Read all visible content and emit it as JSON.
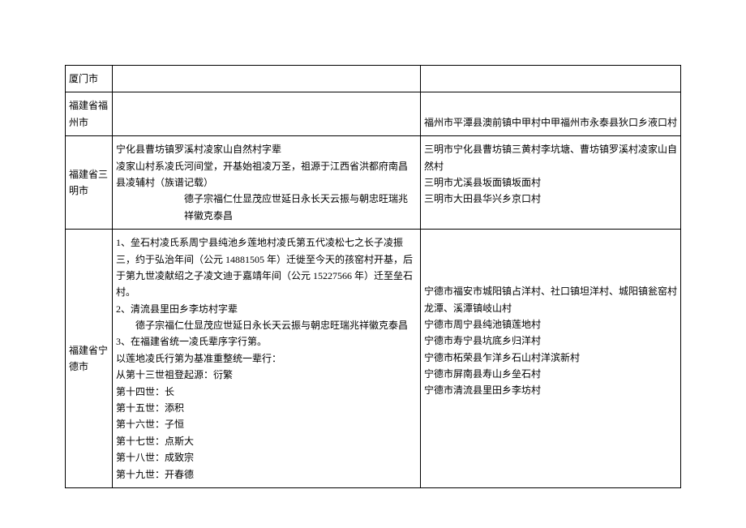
{
  "rows": [
    {
      "region": "厦门市",
      "left": [
        ""
      ],
      "right": [
        ""
      ]
    },
    {
      "region": "福建省福州市",
      "left": [
        ""
      ],
      "right": [
        "福州市平潭县澳前镇中甲村中甲福州市永泰县狄口乡液口村"
      ]
    },
    {
      "region": "福建省三明市",
      "left": [
        "宁化县曹坊镇罗溪村凌家山自然村字辈",
        "凌家山村系凌氏河间堂，开基始祖凌万圣，祖源于江西省洪都府南昌县凌辅村（族谱记载）",
        "德子宗福仁仕显茂应世延日永长天云振与朝忠旺瑞兆祥徽克泰昌"
      ],
      "right": [
        "三明市宁化县曹坊镇三黄村李坑塘、曹坊镇罗溪村凌家山自然村",
        "三明市尤溪县坂面镇坂面村",
        "三明市大田县华兴乡京口村"
      ]
    },
    {
      "region": "福建省宁德市",
      "left": [
        "1、垒石村凌氏系周宁县纯池乡莲地村凌氏第五代凌松七之长子凌振三，约于弘治年间（公元 14881505 年）迁徙至今天的孩窑村开基，后于第九世凌献绍之子凌文迪于嘉靖年间（公元 15227566 年）迁至垒石村。",
        "2、清流县里田乡李坊村字辈",
        "德子宗福仁仕显茂应世延日永长天云振与朝忠旺瑞兆祥徽克泰昌",
        "3、在福建省统一凌氏辈序字行第。",
        "以莲地凌氏行第为基准重整统一辈行：",
        "从第十三世祖登起源：衍繁",
        "第十四世：长",
        "第十五世：添积",
        "第十六世：子恒",
        "第十七世：点斯大",
        "第十八世：成致宗",
        "第十九世：开春德"
      ],
      "right": [
        "宁德市福安市城阳镇占洋村、社口镇坦洋村、城阳镇瓮窑村龙潭、溪潭镇岐山村",
        "宁德市周宁县纯池镇莲地村",
        "宁德市寿宁县坑底乡归洋村",
        "宁德市柘荣县乍洋乡石山村洋滨新村",
        "宁德市屏南县寿山乡垒石村",
        "宁德市清流县里田乡李坊村"
      ]
    }
  ]
}
